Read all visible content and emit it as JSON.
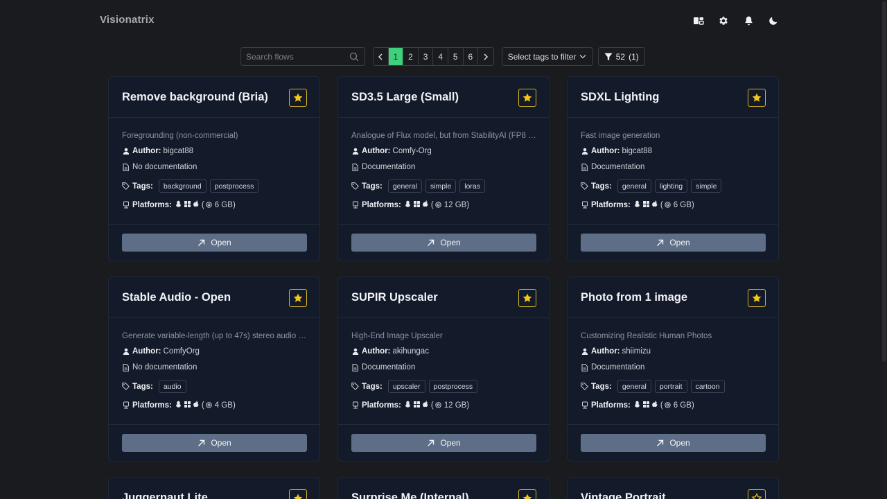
{
  "header": {
    "title": "Visionatrix",
    "icons": [
      "dashboard-icon",
      "gear-icon",
      "bell-icon",
      "moon-icon"
    ]
  },
  "toolbar": {
    "search_placeholder": "Search flows",
    "pages": [
      "1",
      "2",
      "3",
      "4",
      "5",
      "6"
    ],
    "active_page": "1",
    "tag_filter_placeholder": "Select tags to filter",
    "flow_count": "52",
    "flow_count_suffix": "(1)"
  },
  "labels": {
    "author": "Author:",
    "tags": "Tags:",
    "platforms": "Platforms:",
    "open": "Open"
  },
  "colors": {
    "accent": "#3ed07a",
    "star": "#f5c518",
    "card_bg": "#131a2a",
    "open_button": "#5e6e87"
  },
  "cards": [
    {
      "title": "Remove background (Bria)",
      "favorite": true,
      "description": "Foregrounding (non-commercial)",
      "author": "bigcat88",
      "documentation": "No documentation",
      "tags": [
        "background",
        "postprocess"
      ],
      "vram": "6 GB"
    },
    {
      "title": "SD3.5 Large (Small)",
      "favorite": true,
      "description": "Analogue of Flux model, but from StabilityAI (FP8 …",
      "author": "Comfy-Org",
      "documentation": "Documentation",
      "tags": [
        "general",
        "simple",
        "loras"
      ],
      "vram": "12 GB"
    },
    {
      "title": "SDXL Lighting",
      "favorite": true,
      "description": "Fast image generation",
      "author": "bigcat88",
      "documentation": "Documentation",
      "tags": [
        "general",
        "lighting",
        "simple"
      ],
      "vram": "6 GB"
    },
    {
      "title": "Stable Audio - Open",
      "favorite": true,
      "description": "Generate variable-length (up to 47s) stereo audio a…",
      "author": "ComfyOrg",
      "documentation": "No documentation",
      "tags": [
        "audio"
      ],
      "vram": "4 GB"
    },
    {
      "title": "SUPIR Upscaler",
      "favorite": true,
      "description": "High-End Image Upscaler",
      "author": "akihungac",
      "documentation": "Documentation",
      "tags": [
        "upscaler",
        "postprocess"
      ],
      "vram": "12 GB"
    },
    {
      "title": "Photo from 1 image",
      "favorite": true,
      "description": "Customizing Realistic Human Photos",
      "author": "shiimizu",
      "documentation": "Documentation",
      "tags": [
        "general",
        "portrait",
        "cartoon"
      ],
      "vram": "6 GB"
    },
    {
      "title": "Juggernaut Lite",
      "favorite": true,
      "description": "",
      "author": "",
      "documentation": "",
      "tags": [],
      "vram": ""
    },
    {
      "title": "Surprise Me (Internal)",
      "favorite": true,
      "description": "",
      "author": "",
      "documentation": "",
      "tags": [],
      "vram": ""
    },
    {
      "title": "Vintage Portrait",
      "favorite": false,
      "description": "",
      "author": "",
      "documentation": "",
      "tags": [],
      "vram": ""
    }
  ]
}
